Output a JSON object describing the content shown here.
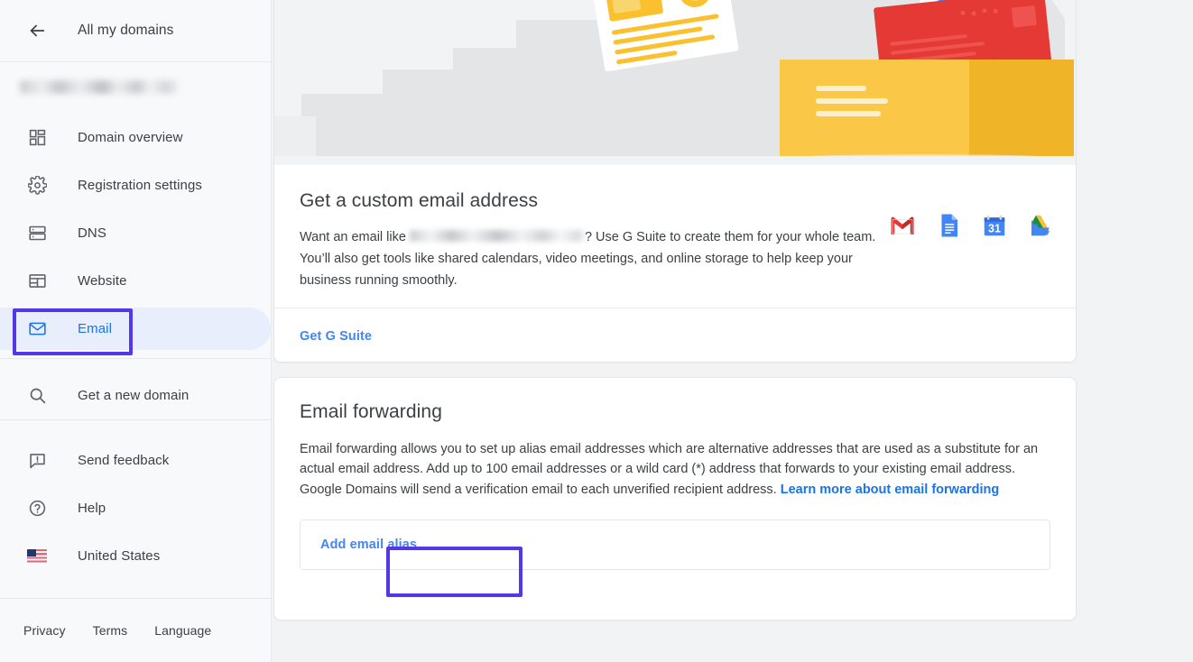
{
  "sidebar": {
    "back_label": "All my domains",
    "domain_name_blurred": "",
    "nav_primary": [
      {
        "label": "Domain overview",
        "icon": "dashboard-icon",
        "selected": false
      },
      {
        "label": "Registration settings",
        "icon": "gear-icon",
        "selected": false
      },
      {
        "label": "DNS",
        "icon": "dns-server-icon",
        "selected": false
      },
      {
        "label": "Website",
        "icon": "website-layout-icon",
        "selected": false
      },
      {
        "label": "Email",
        "icon": "envelope-icon",
        "selected": true
      }
    ],
    "nav_search": [
      {
        "label": "Get a new domain",
        "icon": "search-icon"
      }
    ],
    "nav_secondary": [
      {
        "label": "Send feedback",
        "icon": "feedback-icon"
      },
      {
        "label": "Help",
        "icon": "help-circle-icon"
      },
      {
        "label": "United States",
        "icon": "us-flag-icon"
      }
    ],
    "footer_links": [
      "Privacy",
      "Terms",
      "Language"
    ]
  },
  "main": {
    "promo": {
      "illustration": "open-box-with-mail-illustration",
      "title": "Get a custom email address",
      "text_before_blur": "Want an email like",
      "email_blurred": "",
      "text_after_blur": "? Use G Suite to create them for your whole team. You’ll also get tools like shared calendars, video meetings, and online storage to help keep your business running smoothly.",
      "app_icons": [
        "gmail-icon",
        "google-docs-icon",
        "google-calendar-icon",
        "google-drive-icon"
      ],
      "calendar_day": "31",
      "cta_label": "Get G Suite"
    },
    "forwarding": {
      "title": "Email forwarding",
      "description": "Email forwarding allows you to set up alias email addresses which are alternative addresses that are used as a substitute for an actual email address. Add up to 100 email addresses or a wild card (*) address that forwards to your existing email address. Google Domains will send a verification email to each unverified recipient address.",
      "learn_more_label": "Learn more about email forwarding",
      "add_alias_label": "Add email alias"
    }
  },
  "annotations": {
    "color": "#5438e8",
    "targets": [
      "Email",
      "Add email alias"
    ]
  },
  "colors": {
    "page_background": "#f1f3f4",
    "sidebar_background": "#f8f9fa",
    "card_background": "#ffffff",
    "selected_pill": "#e8eefc",
    "selected_text": "#1a73e8",
    "link_blue": "#4285f4",
    "body_text": "#3c4043",
    "annotation_purple": "#5438e8"
  }
}
